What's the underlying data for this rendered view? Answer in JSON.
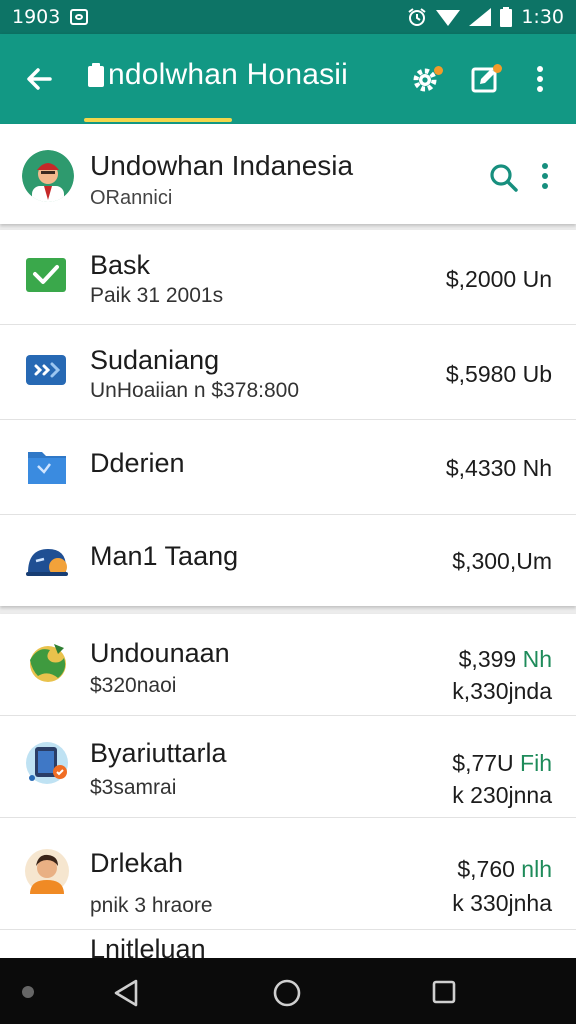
{
  "status": {
    "time": "1:30",
    "left_text": "1903"
  },
  "app_bar": {
    "title": "​ndolwhan Honasii"
  },
  "account": {
    "name": "Undowhan Indanesia",
    "sub": "ORannici"
  },
  "group1": [
    {
      "name": "Bask",
      "sub": "Paik 31 2001s",
      "amount": "$,2000 Un",
      "icon": "check-icon"
    },
    {
      "name": "Sudaniang",
      "sub": "UnHoaiian n $378:800",
      "amount": "$,5980 Ub",
      "icon": "transfer-icon"
    },
    {
      "name": "Dderien",
      "sub": "",
      "amount": "$,4330 Nh",
      "icon": "folder-icon"
    },
    {
      "name": "Man1 Taang",
      "sub": "",
      "amount": "$,300,Um",
      "icon": "helmet-icon"
    }
  ],
  "group2": [
    {
      "name": "Undounaan",
      "sub": "$320naoi",
      "amount_main": "$,399",
      "amount_unit": "Nh",
      "amount_sub": "k,330jnda",
      "icon": "map-icon"
    },
    {
      "name": "Byariuttarla",
      "sub": "$3samrai",
      "amount_main": "$,77U",
      "amount_unit": "Fih",
      "amount_sub": "k 230jnna",
      "icon": "tablet-icon"
    },
    {
      "name": "Drlekah",
      "sub": "pnik 3 hraore",
      "amount_main": "$,760",
      "amount_unit": "nlh",
      "amount_sub": "k 330jnha",
      "icon": "person-icon"
    },
    {
      "name": "Lnitleluan",
      "sub": "",
      "amount_main": "",
      "amount_unit": "",
      "amount_sub": "",
      "icon": "folder-icon"
    }
  ],
  "colors": {
    "primary": "#129884",
    "status_bar": "#0d7466",
    "accent": "#1e8b5a",
    "underline": "#f2d64b"
  }
}
